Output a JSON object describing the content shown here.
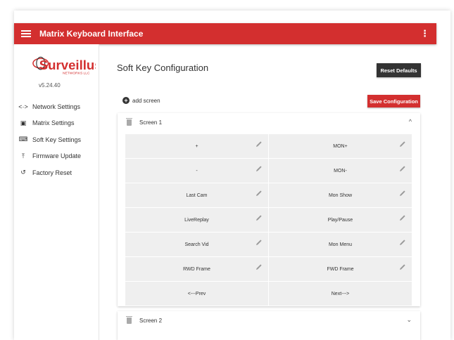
{
  "app": {
    "title": "Matrix Keyboard Interface",
    "kebab": "⋮"
  },
  "sidebar": {
    "logo_text": "Surveillus",
    "logo_sub": "NETWORKS LLC",
    "version": "v5.24.40",
    "items": [
      {
        "label": "Network Settings",
        "icon": "<·>"
      },
      {
        "label": "Matrix Settings",
        "icon": "▣"
      },
      {
        "label": "Soft Key Settings",
        "icon": "⌨"
      },
      {
        "label": "Firmware Update",
        "icon": "⤒"
      },
      {
        "label": "Factory Reset",
        "icon": "↺"
      }
    ]
  },
  "main": {
    "title": "Soft Key Configuration",
    "reset_label": "Reset Defaults",
    "save_label": "Save Configuration",
    "add_label": "add screen",
    "screens": [
      {
        "label": "Screen 1",
        "expanded": true,
        "chevron": "^"
      },
      {
        "label": "Screen 2",
        "expanded": false,
        "chevron": "⌄"
      }
    ],
    "keys": [
      {
        "label": "+",
        "editable": true
      },
      {
        "label": "MON+",
        "editable": true
      },
      {
        "label": "-",
        "editable": true
      },
      {
        "label": "MON-",
        "editable": true
      },
      {
        "label": "Last Cam",
        "editable": true
      },
      {
        "label": "Mon Show",
        "editable": true
      },
      {
        "label": "LiveReplay",
        "editable": true
      },
      {
        "label": "Play/Pause",
        "editable": true
      },
      {
        "label": "Search Vid",
        "editable": true
      },
      {
        "label": "Mon Menu",
        "editable": true
      },
      {
        "label": "RWD Frame",
        "editable": true
      },
      {
        "label": "FWD Frame",
        "editable": true
      },
      {
        "label": "<---Prev",
        "editable": false
      },
      {
        "label": "Next--->",
        "editable": false
      }
    ]
  },
  "colors": {
    "primary": "#d32f2f",
    "dark": "#333333",
    "cell": "#efefef"
  }
}
